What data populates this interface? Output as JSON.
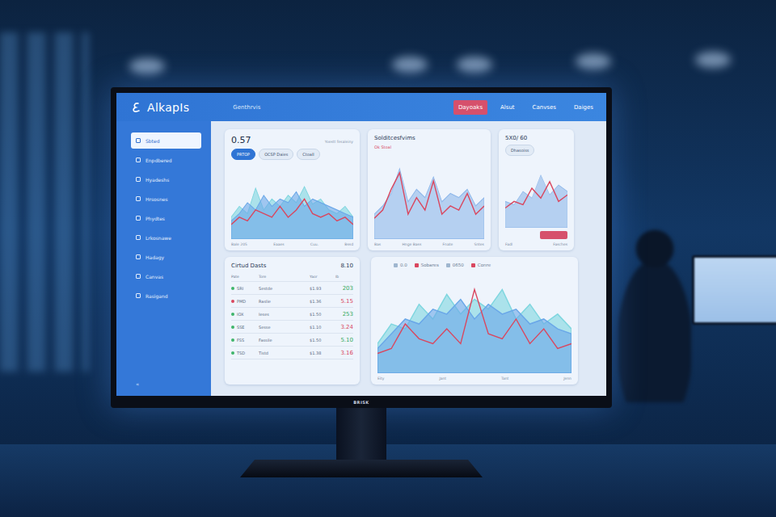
{
  "window": {
    "title": "AlkapIs",
    "subtitle": "Genthrvis"
  },
  "topbar": {
    "nav": [
      {
        "label": "Dayoaks",
        "selected": true
      },
      {
        "label": "Alsut",
        "selected": false
      },
      {
        "label": "Canvses",
        "selected": false
      },
      {
        "label": "Daiges",
        "selected": false
      }
    ]
  },
  "sidebar": {
    "items": [
      {
        "label": "Sbted",
        "selected": true
      },
      {
        "label": "Enpdbered",
        "selected": false
      },
      {
        "label": "Hyadeshs",
        "selected": false
      },
      {
        "label": "Hrsosnes",
        "selected": false
      },
      {
        "label": "Phydtes",
        "selected": false
      },
      {
        "label": "Lrkosnawe",
        "selected": false
      },
      {
        "label": "Hadagy",
        "selected": false
      },
      {
        "label": "Canvas",
        "selected": false
      },
      {
        "label": "Rasigand",
        "selected": false
      }
    ],
    "footer": "«"
  },
  "overview": {
    "value": "0.57",
    "meta": "Yoestt fesaleiny",
    "pills": [
      {
        "label": "PRTOP",
        "selected": true
      },
      {
        "label": "OCSP Daies",
        "selected": false
      },
      {
        "label": "Ctoall",
        "selected": false
      }
    ],
    "chart": {
      "series": [
        {
          "kind": "area",
          "color": "#7fd6df",
          "values": [
            30,
            45,
            35,
            70,
            40,
            55,
            45,
            60,
            50,
            72,
            48,
            55,
            40,
            35,
            45,
            30
          ]
        },
        {
          "kind": "area",
          "color": "#6aa7e8",
          "values": [
            25,
            35,
            50,
            40,
            60,
            45,
            55,
            50,
            65,
            45,
            55,
            50,
            45,
            40,
            35,
            30
          ]
        },
        {
          "kind": "line",
          "color": "#d9475f",
          "values": [
            20,
            30,
            25,
            40,
            35,
            30,
            45,
            30,
            40,
            55,
            35,
            30,
            35,
            25,
            30,
            20
          ]
        }
      ],
      "x_labels": [
        "Bale 205",
        "Eaaes",
        "Cuu.",
        "Bssd"
      ]
    }
  },
  "solditces": {
    "title": "Solditcesfvims",
    "subtitle": "Ok Stoal",
    "chart": {
      "series": [
        {
          "kind": "area",
          "color": "#8fb8ea",
          "values": [
            30,
            40,
            55,
            85,
            45,
            60,
            50,
            75,
            45,
            55,
            50,
            60,
            40,
            50
          ]
        },
        {
          "kind": "line",
          "color": "#d9475f",
          "values": [
            25,
            35,
            60,
            80,
            30,
            50,
            35,
            70,
            30,
            40,
            35,
            55,
            30,
            40
          ]
        }
      ],
      "x_labels": [
        "Bas",
        "Hnge Bass",
        "Fnate",
        "Sntes"
      ]
    }
  },
  "ratio": {
    "title": "5X0/ 60",
    "pill": "Dhasoiss",
    "chart": {
      "series": [
        {
          "kind": "area",
          "color": "#8fb8ea",
          "values": [
            40,
            35,
            55,
            45,
            80,
            50,
            65,
            55
          ]
        },
        {
          "kind": "line",
          "color": "#d9475f",
          "values": [
            30,
            40,
            35,
            60,
            45,
            70,
            40,
            50
          ]
        }
      ],
      "x_labels": [
        "Fadl",
        "Fasches"
      ]
    }
  },
  "orders": {
    "title": "Cirtud Dasts",
    "value": "8.10",
    "columns": [
      "Pate",
      "Tore",
      "Yaor",
      "Ib"
    ],
    "rows": [
      {
        "code": "SRI",
        "name": "Sestde",
        "price": "$1.93",
        "value": "203",
        "color": "#3fb56b",
        "up": true
      },
      {
        "code": "PMD",
        "name": "Raslie",
        "price": "$1.36",
        "value": "5.15",
        "color": "#d9475f",
        "up": false
      },
      {
        "code": "IOX",
        "name": "Ieses",
        "price": "$1.50",
        "value": "253",
        "color": "#3fb56b",
        "up": true
      },
      {
        "code": "SSE",
        "name": "Sesse",
        "price": "$1.10",
        "value": "3.24",
        "color": "#3fb56b",
        "up": false
      },
      {
        "code": "FSS",
        "name": "Fassile",
        "price": "$1.50",
        "value": "5.10",
        "color": "#3fb56b",
        "up": true
      },
      {
        "code": "TSD",
        "name": "Tistd",
        "price": "$1.38",
        "value": "3.16",
        "color": "#3fb56b",
        "up": false
      }
    ]
  },
  "trend": {
    "legend": [
      {
        "label": "0.0",
        "color": "#9fb6cf"
      },
      {
        "label": "Sobares",
        "color": "#d9475f"
      },
      {
        "label": "0650",
        "color": "#9fb6cf"
      },
      {
        "label": "Conre",
        "color": "#d9475f"
      }
    ],
    "chart": {
      "series": [
        {
          "kind": "area",
          "color": "#7fd6df",
          "values": [
            30,
            50,
            45,
            70,
            55,
            80,
            60,
            75,
            65,
            85,
            55,
            70,
            50,
            60,
            45
          ]
        },
        {
          "kind": "area",
          "color": "#6aa7e8",
          "values": [
            25,
            40,
            55,
            50,
            65,
            60,
            75,
            55,
            70,
            60,
            65,
            50,
            55,
            45,
            40
          ]
        },
        {
          "kind": "line",
          "color": "#d9475f",
          "values": [
            20,
            25,
            50,
            35,
            30,
            45,
            30,
            85,
            40,
            35,
            55,
            30,
            45,
            25,
            30
          ]
        }
      ],
      "x_labels": [
        "Eity",
        "Jant",
        "Tant",
        "Jenn"
      ]
    }
  },
  "monitor": {
    "brand": "BRISK"
  }
}
